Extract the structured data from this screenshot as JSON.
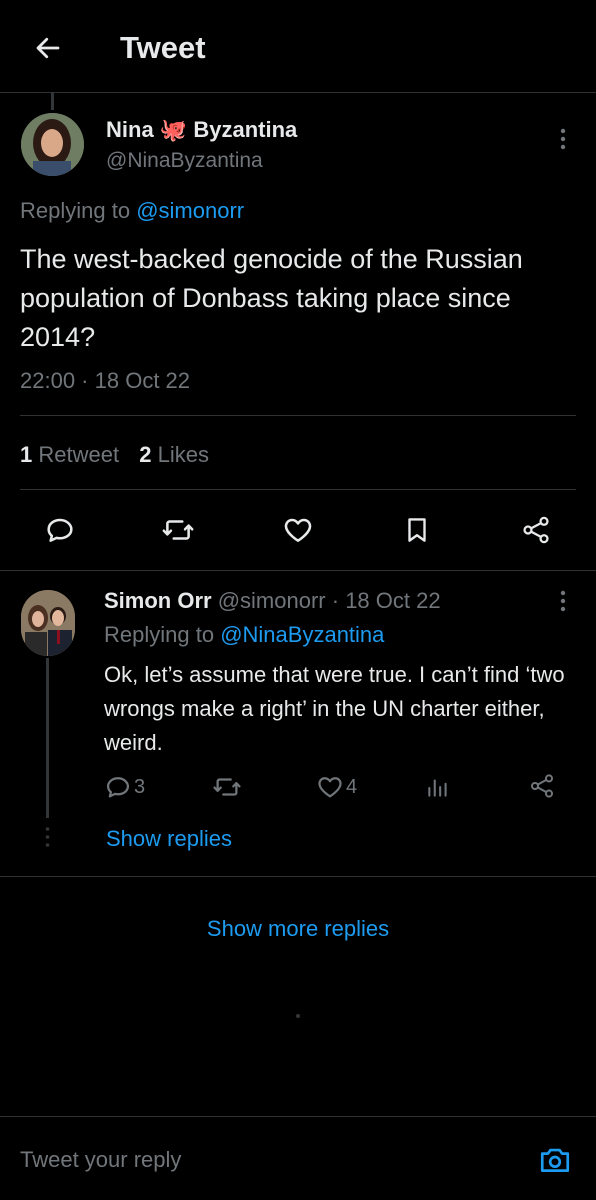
{
  "header": {
    "title": "Tweet"
  },
  "tweet": {
    "author_first": "Nina",
    "author_emoji": "🐙",
    "author_last": "Byzantina",
    "handle": "@NinaByzantina",
    "replying_prefix": "Replying to",
    "replying_to": "@simonorr",
    "text": "The west-backed genocide of the Russian population of Donbass taking place since 2014?",
    "time": "22:00",
    "date": "18 Oct 22",
    "retweets_count": "1",
    "retweets_label": "Retweet",
    "likes_count": "2",
    "likes_label": "Likes"
  },
  "reply": {
    "author": "Simon Orr",
    "handle": "@simonorr",
    "date": "18 Oct 22",
    "replying_prefix": "Replying to",
    "replying_to": "@NinaByzantina",
    "text": "Ok, let’s assume that were true. I  can’t find ‘two wrongs make a right’ in the UN charter either, weird.",
    "reply_count": "3",
    "like_count": "4",
    "show_replies": "Show replies"
  },
  "show_more_replies": "Show more replies",
  "composer": {
    "placeholder": "Tweet your reply"
  },
  "colors": {
    "accent": "#1d9bf0",
    "muted": "#71767b",
    "text": "#e7e9ea",
    "divider": "#2f3336"
  }
}
